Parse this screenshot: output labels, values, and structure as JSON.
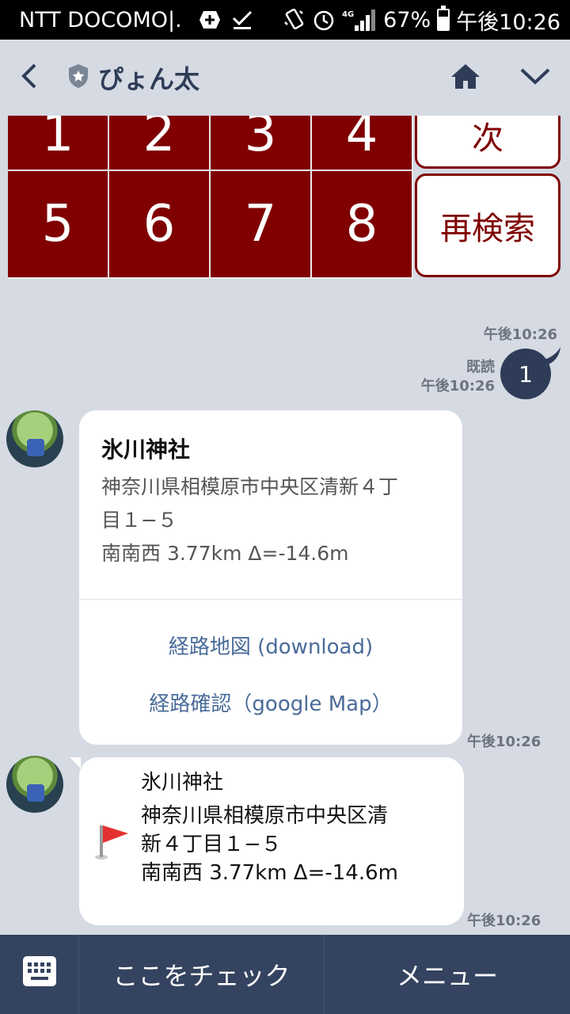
{
  "status_bar": {
    "carrier": "NTT DOCOMO|.",
    "network": "4G",
    "battery": "67%",
    "battery_level": 0.67,
    "time": "午後10:26",
    "icons": [
      "plus-box-icon",
      "check-download-icon",
      "vibrate-icon",
      "alarm-clock-icon",
      "signal-icon",
      "battery-icon"
    ]
  },
  "header": {
    "back_icon": "chevron-left-icon",
    "badge_icon": "shield-star-icon",
    "title": "ぴょん太",
    "home_icon": "home-icon",
    "menu_icon": "chevron-down-icon"
  },
  "rich_menu": {
    "numbers": [
      "1",
      "2",
      "3",
      "4",
      "5",
      "6",
      "7",
      "8"
    ],
    "next_label": "次",
    "research_label": "再検索"
  },
  "messages": {
    "ts_menu": "午後10:26",
    "sent": {
      "text": "1",
      "read_label": "既読",
      "time": "午後10:26"
    },
    "card": {
      "title": "氷川神社",
      "address_line1": "神奈川県相模原市中央区清新４丁",
      "address_line2": "目１−５",
      "direction": "南南西  3.77km Δ=-14.6m",
      "link1": "経路地図 (download)",
      "link2": "経路確認（google Map）",
      "time": "午後10:26"
    },
    "location": {
      "icon": "red-flag-icon",
      "name": "氷川神社",
      "address_line1": "神奈川県相模原市中央区清",
      "address_line2": "新４丁目１−５",
      "direction": "南南西  3.77km Δ=-14.6m",
      "time": "午後10:26"
    }
  },
  "bottom_bar": {
    "keyboard_icon": "keyboard-icon",
    "check_label": "ここをチェック",
    "menu_label": "メニュー"
  },
  "colors": {
    "maroon": "#800000",
    "navy": "#2e3c58",
    "bottom_bar": "#34435f",
    "chat_bg": "#d5dae3",
    "link": "#4a6b9a"
  }
}
